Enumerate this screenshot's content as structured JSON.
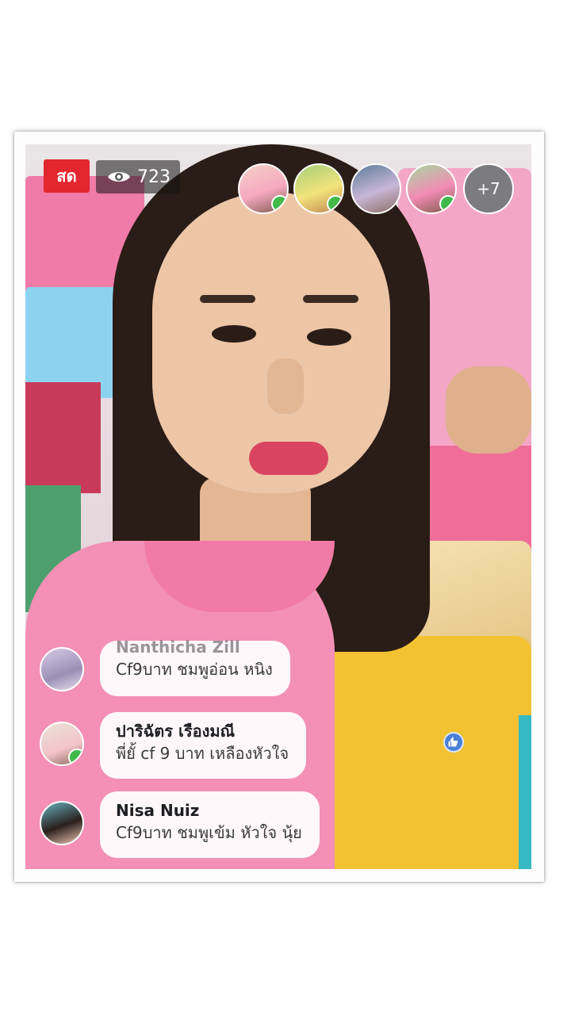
{
  "live": {
    "badge_label": "สด",
    "viewer_count": "723",
    "viewer_icon": "eye-icon"
  },
  "guests": {
    "items": [
      {
        "label": "guest-1",
        "camera_on": true
      },
      {
        "label": "guest-2",
        "camera_on": true
      },
      {
        "label": "guest-3",
        "camera_on": false
      },
      {
        "label": "guest-4",
        "camera_on": true
      },
      {
        "label": "guest-5",
        "camera_on": false
      }
    ],
    "more_label": "+7"
  },
  "comments": [
    {
      "name": "Nanthicha Zill",
      "text": "Cf9บาท ชมพูอ่อน หนิง",
      "camera_on": false
    },
    {
      "name": "ปาริฉัตร เรืองมณี",
      "text": "พี่ยั้ cf 9 บาท เหลืองหัวใจ",
      "camera_on": true
    },
    {
      "name": "Nisa Nuiz",
      "text": "Cf9บาท ชมพูเข้ม หัวใจ นุ้ย",
      "camera_on": false
    }
  ],
  "colors": {
    "live_red": "#e3262f",
    "camera_green": "#41b94a",
    "like_blue": "#4a7fd6"
  }
}
